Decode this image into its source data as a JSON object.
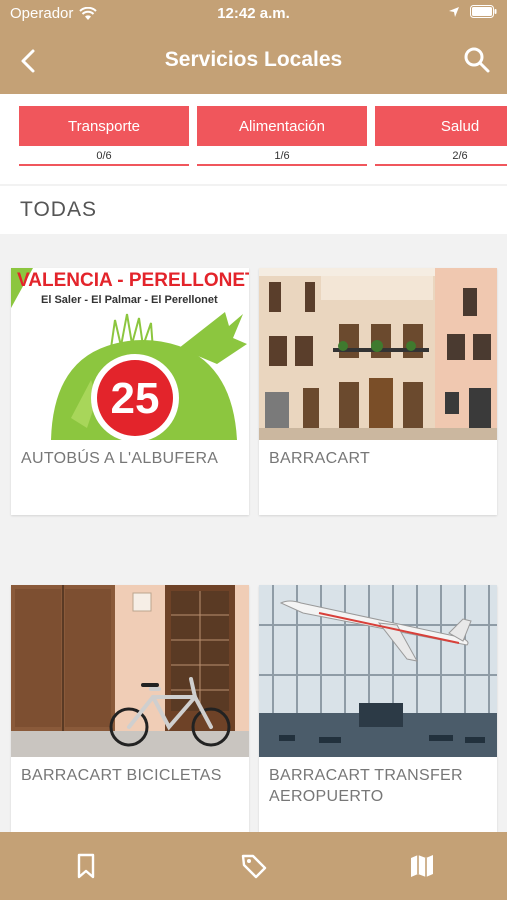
{
  "status": {
    "carrier": "Operador",
    "time": "12:42 a.m."
  },
  "nav": {
    "title": "Servicios Locales",
    "back_icon": "chevron-left-icon",
    "search_icon": "search-icon"
  },
  "categories": [
    {
      "label": "Transporte",
      "count": "0/6"
    },
    {
      "label": "Alimentación",
      "count": "1/6"
    },
    {
      "label": "Salud",
      "count": "2/6"
    }
  ],
  "section": {
    "title": "TODAS"
  },
  "cards": [
    {
      "label": "AUTOBÚS A L'ALBUFERA",
      "thumb": {
        "title": "VALENCIA - PERELLONET",
        "subtitle": "El Saler - El Palmar - El Perellonet",
        "number": "25"
      }
    },
    {
      "label": "BARRACART"
    },
    {
      "label": "BARRACART BICICLETAS"
    },
    {
      "label": "BARRACART TRANSFER AEROPUERTO"
    }
  ],
  "tabbar": {
    "items": [
      "bookmark-icon",
      "tag-icon",
      "map-icon"
    ]
  },
  "colors": {
    "header": "#c4a176",
    "accent": "#f0565c"
  }
}
